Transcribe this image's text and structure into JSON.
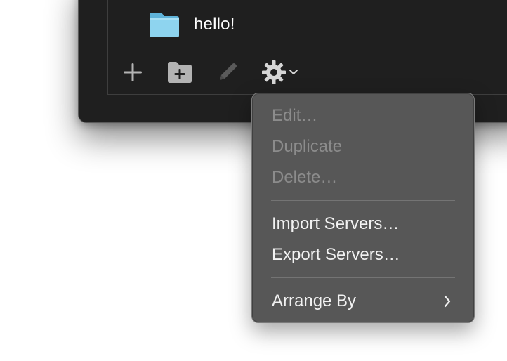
{
  "list": {
    "items": [
      {
        "label": "hello!",
        "icon": "folder-icon"
      }
    ]
  },
  "toolbar": {
    "buttons": [
      {
        "name": "add-server-button",
        "icon": "plus-icon",
        "enabled": true
      },
      {
        "name": "add-folder-button",
        "icon": "folder-plus-icon",
        "enabled": true
      },
      {
        "name": "edit-button",
        "icon": "pencil-icon",
        "enabled": false
      },
      {
        "name": "action-menu-button",
        "icon": "gear-icon",
        "enabled": true
      }
    ]
  },
  "menu": {
    "items": [
      {
        "label": "Edit…",
        "enabled": false
      },
      {
        "label": "Duplicate",
        "enabled": false
      },
      {
        "label": "Delete…",
        "enabled": false
      },
      {
        "separator": true
      },
      {
        "label": "Import Servers…",
        "enabled": true
      },
      {
        "label": "Export Servers…",
        "enabled": true
      },
      {
        "separator": true
      },
      {
        "label": "Arrange By",
        "enabled": true,
        "submenu": true
      }
    ]
  },
  "colors": {
    "window_bg": "#1f1f1f",
    "menu_bg": "#575757",
    "text_enabled": "#f2f2f2",
    "text_disabled": "#8c8c8c",
    "folder_blue": "#7ccbea"
  }
}
